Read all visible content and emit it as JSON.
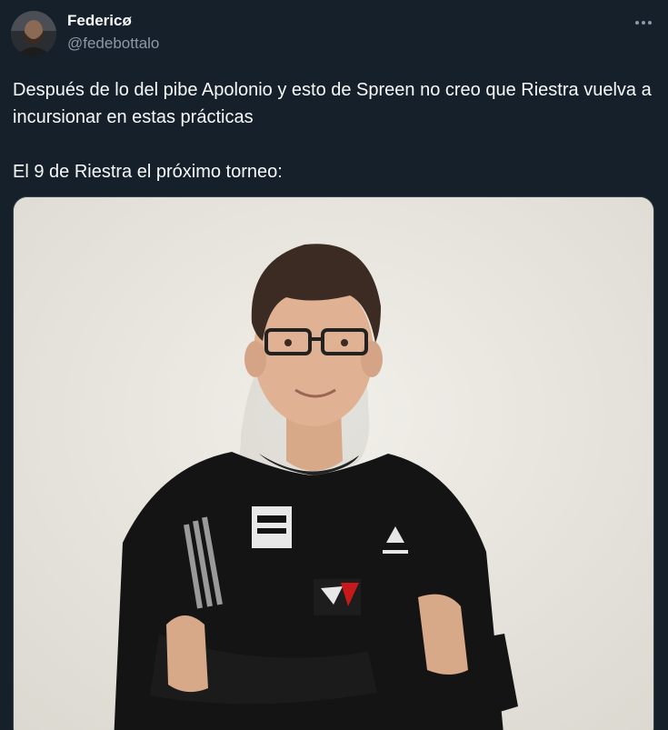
{
  "author": {
    "display_name": "Federicø",
    "handle": "@fedebottalo"
  },
  "tweet": {
    "paragraph_1": "Después de lo del pibe Apolonio y esto de Spreen no creo que Riestra vuelva a incursionar en estas prácticas",
    "paragraph_2": "El 9 de Riestra el próximo torneo:"
  },
  "icons": {
    "more": "more-options-icon"
  },
  "colors": {
    "background": "#15202b",
    "text_primary": "#f7f9f9",
    "text_secondary": "#8b98a5",
    "border": "#38444d"
  }
}
